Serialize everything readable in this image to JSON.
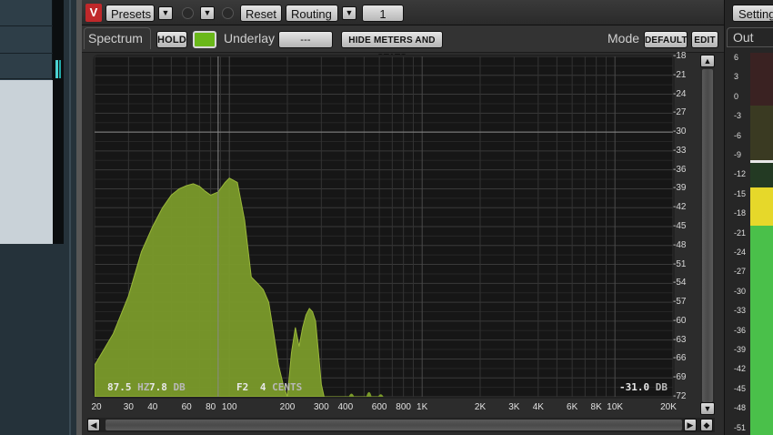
{
  "toolbar": {
    "logo": "V",
    "presets_label": "Presets",
    "reset_label": "Reset",
    "routing_label": "Routing",
    "routing_value": "1",
    "settings_label": "Settings"
  },
  "options": {
    "spectrum_tab": "Spectrum",
    "hold_label": "HOLD",
    "underlay_label": "Underlay",
    "underlay_value": "---",
    "hide_meters_label": "HIDE METERS AND STATS",
    "mode_label": "Mode",
    "mode_value": "DEFAULT",
    "edit_label": "EDIT",
    "hold_color": "#6ab81a"
  },
  "readouts": {
    "freq_value": "87.5",
    "freq_unit": "HZ",
    "db_value": "7.8",
    "db_unit": "DB",
    "note": "F2",
    "cents_value": "4",
    "cents_unit": "CENTS",
    "level_value": "-31.0",
    "level_unit": "DB"
  },
  "db_scale": [
    "-18",
    "-21",
    "-24",
    "-27",
    "-30",
    "-33",
    "-36",
    "-39",
    "-42",
    "-45",
    "-48",
    "-51",
    "-54",
    "-57",
    "-60",
    "-63",
    "-66",
    "-69",
    "-72"
  ],
  "freq_labels": [
    "20",
    "30",
    "40",
    "60",
    "80",
    "100",
    "200",
    "300",
    "400",
    "600",
    "800",
    "1K",
    "2K",
    "3K",
    "4K",
    "6K",
    "8K",
    "10K",
    "20K"
  ],
  "output": {
    "label": "Out",
    "ticks": [
      "6",
      "3",
      "0",
      "-3",
      "-6",
      "-9",
      "-12",
      "-15",
      "-18",
      "-21",
      "-24",
      "-27",
      "-30",
      "-33",
      "-36",
      "-39",
      "-42",
      "-45",
      "-48",
      "-51"
    ]
  },
  "chart_data": {
    "type": "area",
    "x_scale": "log",
    "xlim": [
      20,
      20000
    ],
    "ylim": [
      -72,
      -18
    ],
    "grid": true,
    "series": [
      {
        "color": "#7a9a2a",
        "x": [
          20,
          25,
          30,
          35,
          40,
          45,
          50,
          55,
          60,
          65,
          70,
          75,
          80,
          87.5,
          95,
          100,
          110,
          120,
          130,
          140,
          150,
          160,
          170,
          180,
          190,
          200,
          210,
          220,
          230,
          240,
          250,
          260,
          270,
          280,
          290,
          300,
          310,
          320,
          330,
          340,
          350,
          360,
          380,
          400,
          450,
          500,
          550,
          600
        ],
        "y": [
          -67,
          -62,
          -56,
          -49,
          -45,
          -42,
          -40,
          -39,
          -38.5,
          -38.2,
          -38.6,
          -39.4,
          -40,
          -39.5,
          -38,
          -37.3,
          -38,
          -44,
          -53,
          -54,
          -55,
          -57,
          -62,
          -67,
          -70,
          -72,
          -65,
          -61,
          -64,
          -61,
          -59,
          -58,
          -58.5,
          -60,
          -65,
          -70,
          -72,
          -72,
          -72,
          -72,
          -72,
          -72,
          -72,
          -72,
          -72,
          -72,
          -72,
          -72
        ]
      }
    ],
    "cursor_x": 87.5,
    "cursor_y": -30
  }
}
